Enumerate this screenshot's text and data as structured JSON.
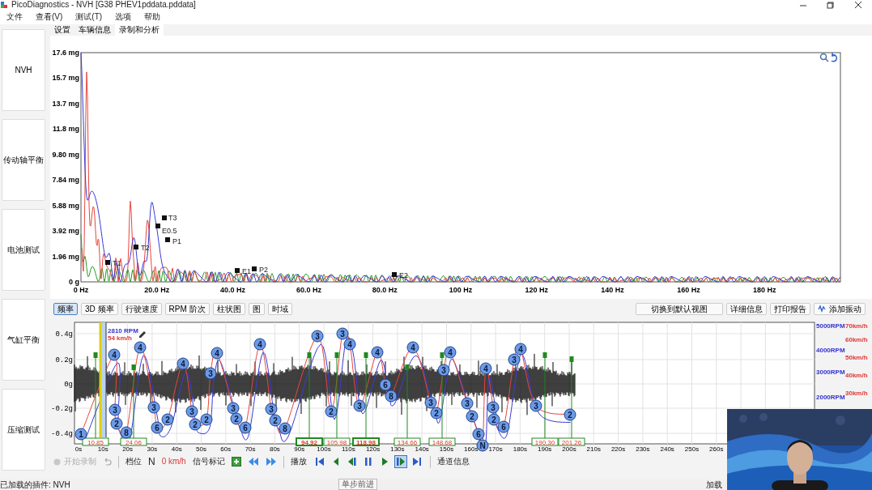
{
  "window": {
    "title": "PicoDiagnostics - NVH [G38 PHEV1pddata.pddata]"
  },
  "menu": [
    "文件",
    "查看(V)",
    "测试(T)",
    "选项",
    "帮助"
  ],
  "sidebar": [
    "NVH",
    "传动轴平衡",
    "电池测试",
    "气缸平衡",
    "压缩测试"
  ],
  "tabs": [
    {
      "label": "设置",
      "selected": false
    },
    {
      "label": "车辆信息",
      "selected": false
    },
    {
      "label": "录制和分析",
      "selected": true
    }
  ],
  "spectrum": {
    "y_ticks": [
      "17.6 mg",
      "15.7 mg",
      "13.7 mg",
      "11.8 mg",
      "9.80 mg",
      "7.84 mg",
      "5.88 mg",
      "3.92 mg",
      "1.96 mg",
      "0 g"
    ],
    "x_ticks": [
      "0 Hz",
      "20.0 Hz",
      "40.0 Hz",
      "60.0 Hz",
      "80.0 Hz",
      "100 Hz",
      "120 Hz",
      "140 Hz",
      "160 Hz",
      "180 Hz"
    ],
    "markers": [
      "T1",
      "T2",
      "T3",
      "E0.5",
      "P1",
      "E1",
      "P2",
      "E2"
    ]
  },
  "view_buttons": [
    {
      "label": "频率",
      "selected": true
    },
    {
      "label": "3D 频率",
      "selected": false
    },
    {
      "label": "行驶速度",
      "selected": false
    },
    {
      "label": "RPM 阶次",
      "selected": false
    },
    {
      "label": "柱状图",
      "selected": false
    },
    {
      "label": "图",
      "selected": false
    },
    {
      "label": "时域",
      "selected": false
    }
  ],
  "action_buttons": [
    {
      "label": "切换到默认视图",
      "kind": "text"
    },
    {
      "label": "详细信息",
      "kind": "text"
    },
    {
      "label": "打印报告",
      "kind": "text"
    },
    {
      "label": "添加振动",
      "kind": "icon"
    }
  ],
  "timeline": {
    "y_ticks": [
      "0.4g",
      "0.2g",
      "0g",
      "-0.2g",
      "-0.4g"
    ],
    "x_ticks": [
      "0s",
      "10s",
      "20s",
      "30s",
      "40s",
      "50s",
      "60s",
      "70s",
      "80s",
      "90s",
      "100s",
      "110s",
      "120s",
      "130s",
      "140s",
      "150s",
      "160s",
      "170s",
      "180s",
      "190s",
      "200s",
      "210s",
      "220s",
      "230s",
      "240s",
      "250s",
      "260s"
    ],
    "rpm_ticks": [
      "5000RPM",
      "4000RPM",
      "3000RPM",
      "2000RPM"
    ],
    "speed_ticks": [
      "70km/h",
      "60km/h",
      "50km/h",
      "40km/h",
      "30km/h"
    ],
    "cursor_rpm": "2810 RPM",
    "cursor_speed": "54 km/h",
    "markers": [
      "1",
      "4",
      "3",
      "2",
      "8",
      "4",
      "3",
      "6",
      "2",
      "4",
      "3",
      "2",
      "2",
      "3",
      "4",
      "3",
      "2",
      "6",
      "4",
      "3",
      "2",
      "8",
      "3",
      "2",
      "3",
      "4",
      "3",
      "4",
      "6",
      "8",
      "4",
      "3",
      "2",
      "3",
      "4",
      "3",
      "2",
      "6",
      "N",
      "4",
      "3",
      "2",
      "6",
      "3",
      "4",
      "3",
      "2"
    ],
    "events": [
      {
        "time": "10.85",
        "highlighted": false
      },
      {
        "time": "24.06",
        "highlighted": false
      },
      {
        "time": "94.92",
        "highlighted": true
      },
      {
        "time": "105.98",
        "highlighted": false
      },
      {
        "time": "118.98",
        "highlighted": true
      },
      {
        "time": "134.66",
        "highlighted": false
      },
      {
        "time": "148.68",
        "highlighted": false
      },
      {
        "time": "190.30",
        "highlighted": false
      },
      {
        "time": "201.26",
        "highlighted": false
      }
    ]
  },
  "controls": {
    "record": {
      "label": "开始录制",
      "disabled": true
    },
    "gear_label": "档位",
    "gear": "N",
    "speed": "0 km/h",
    "signal_mark": "信号标记",
    "play_label": "播放",
    "channel_info": "通道信息"
  },
  "transport": [
    {
      "kind": "first",
      "selected": false
    },
    {
      "kind": "prev",
      "selected": false
    },
    {
      "kind": "step_back",
      "selected": false
    },
    {
      "kind": "pause",
      "selected": false
    },
    {
      "kind": "play",
      "selected": false
    },
    {
      "kind": "step_forward",
      "selected": true
    },
    {
      "kind": "last",
      "selected": false
    }
  ],
  "tooltip": "单步前进",
  "status_bar": {
    "left": "已加载的插件: NVH",
    "right": "加载"
  }
}
